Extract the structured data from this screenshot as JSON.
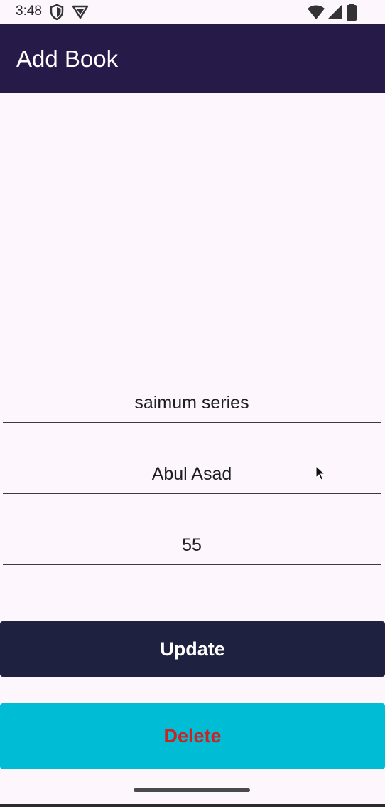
{
  "status_bar": {
    "time": "3:48",
    "icons": [
      "shield-icon",
      "vpn-icon",
      "wifi-icon",
      "signal-icon",
      "battery-icon"
    ]
  },
  "app_bar": {
    "title": "Add Book",
    "background": "#261A48"
  },
  "form": {
    "book_name": "saimum series",
    "author_name": "Abul Asad",
    "pages": "55"
  },
  "buttons": {
    "update_label": "Update",
    "delete_label": "Delete"
  },
  "colors": {
    "background": "#FDF6FD",
    "update_button": "#1E2240",
    "delete_button": "#00BCD4",
    "delete_text": "#CC2222"
  }
}
